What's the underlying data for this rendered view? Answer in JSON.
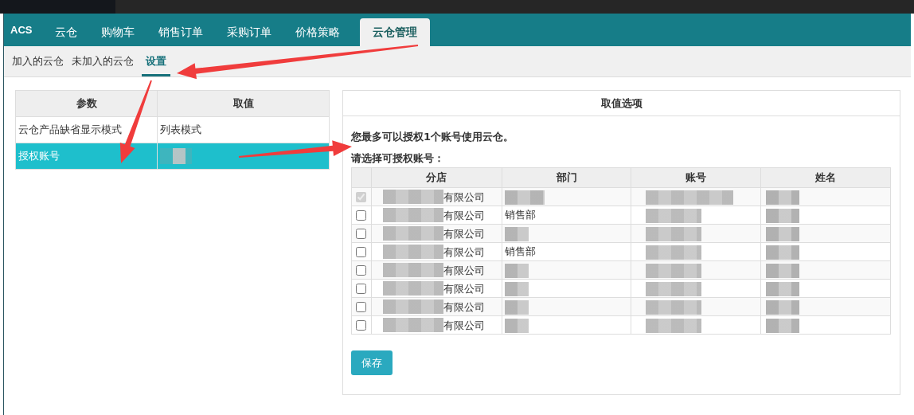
{
  "nav": {
    "brand": "ACS",
    "tabs": [
      {
        "label": "云仓",
        "selected": false
      },
      {
        "label": "购物车",
        "selected": false
      },
      {
        "label": "销售订单",
        "selected": false
      },
      {
        "label": "采购订单",
        "selected": false
      },
      {
        "label": "价格策略",
        "selected": false
      },
      {
        "label": "云仓管理",
        "selected": true
      }
    ]
  },
  "subtabs": [
    {
      "label": "加入的云仓",
      "selected": false
    },
    {
      "label": "未加入的云仓",
      "selected": false
    },
    {
      "label": "设置",
      "selected": true
    }
  ],
  "settings_table": {
    "columns": [
      "参数",
      "取值"
    ],
    "rows": [
      {
        "param": "云仓产品缺省显示模式",
        "value": "列表模式",
        "selected": false
      },
      {
        "param": "授权账号",
        "selected": true
      }
    ]
  },
  "options_panel": {
    "title": "取值选项",
    "notice": "您最多可以授权1个账号使用云仓。",
    "prompt": "请选择可授权账号：",
    "table": {
      "columns": [
        "分店",
        "部门",
        "账号",
        "姓名"
      ],
      "rows": [
        {
          "checked": true,
          "disabled": true,
          "branch": "有限公司"
        },
        {
          "checked": false,
          "disabled": false,
          "branch": "有限公司",
          "department": "销售部"
        },
        {
          "checked": false,
          "disabled": false,
          "branch": "有限公司"
        },
        {
          "checked": false,
          "disabled": false,
          "branch": "有限公司",
          "department": "销售部"
        },
        {
          "checked": false,
          "disabled": false,
          "branch": "有限公司"
        },
        {
          "checked": false,
          "disabled": false,
          "branch": "有限公司"
        },
        {
          "checked": false,
          "disabled": false,
          "branch": "有限公司"
        },
        {
          "checked": false,
          "disabled": false,
          "branch": "有限公司"
        }
      ]
    },
    "save_button": "保存"
  }
}
